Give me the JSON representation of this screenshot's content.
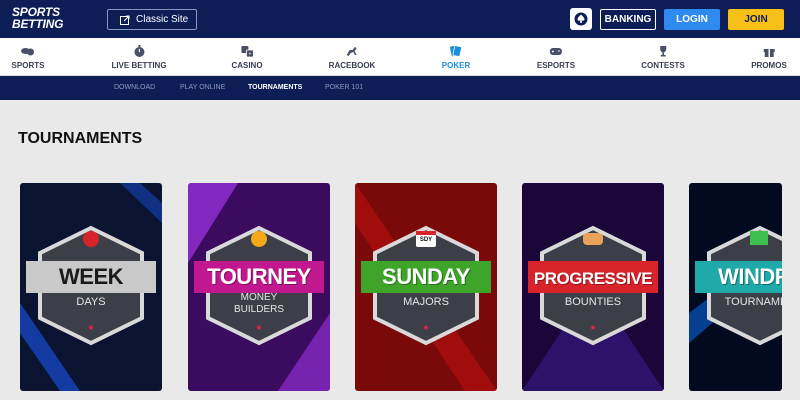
{
  "header": {
    "logo_line1": "SPORTS",
    "logo_line2": "BETTING",
    "classic_site": "Classic Site",
    "banking": "BANKING",
    "login": "LOGIN",
    "join": "JOIN"
  },
  "main_nav": [
    {
      "label": "SPORTS",
      "icon": "sports-icon"
    },
    {
      "label": "LIVE BETTING",
      "icon": "stopwatch-icon"
    },
    {
      "label": "CASINO",
      "icon": "dice-icon"
    },
    {
      "label": "RACEBOOK",
      "icon": "horse-icon"
    },
    {
      "label": "POKER",
      "icon": "cards-icon",
      "active": true
    },
    {
      "label": "ESPORTS",
      "icon": "gamepad-icon"
    },
    {
      "label": "CONTESTS",
      "icon": "trophy-icon"
    },
    {
      "label": "PROMOS",
      "icon": "gift-icon"
    }
  ],
  "sub_nav": [
    {
      "label": "DOWNLOAD"
    },
    {
      "label": "PLAY ONLINE"
    },
    {
      "label": "TOURNAMENTS",
      "active": true
    },
    {
      "label": "POKER 101"
    }
  ],
  "page_title": "TOURNAMENTS",
  "cards": [
    {
      "title": "WEEK",
      "subtitle": "DAYS",
      "banner_color": "#c9c9c9",
      "bg": "#0a1430",
      "accent": "#1e5bff"
    },
    {
      "title": "TOURNEY",
      "subtitle_line1": "MONEY",
      "subtitle_line2": "BUILDERS",
      "banner_color": "#c2188f",
      "bg": "#3a0b5e",
      "accent": "#b23cff"
    },
    {
      "title": "SUNDAY",
      "subtitle": "MAJORS",
      "badge_text": "SDY",
      "banner_color": "#3fa52a",
      "bg": "#7a0a0a",
      "accent": "#d01010"
    },
    {
      "title": "PROGRESSIVE",
      "subtitle": "BOUNTIES",
      "banner_color": "#d8232a",
      "bg": "#1a0638",
      "accent": "#3a1a8c"
    },
    {
      "title": "WINDFA",
      "subtitle": "TOURNAMEN",
      "banner_color": "#1fa9a9",
      "bg": "#020a20",
      "accent": "#0a74ff"
    }
  ],
  "colors": {
    "header_bg": "#0d1d56",
    "active_nav": "#1a8fe0",
    "login": "#2f8af0",
    "join": "#f7c016"
  }
}
